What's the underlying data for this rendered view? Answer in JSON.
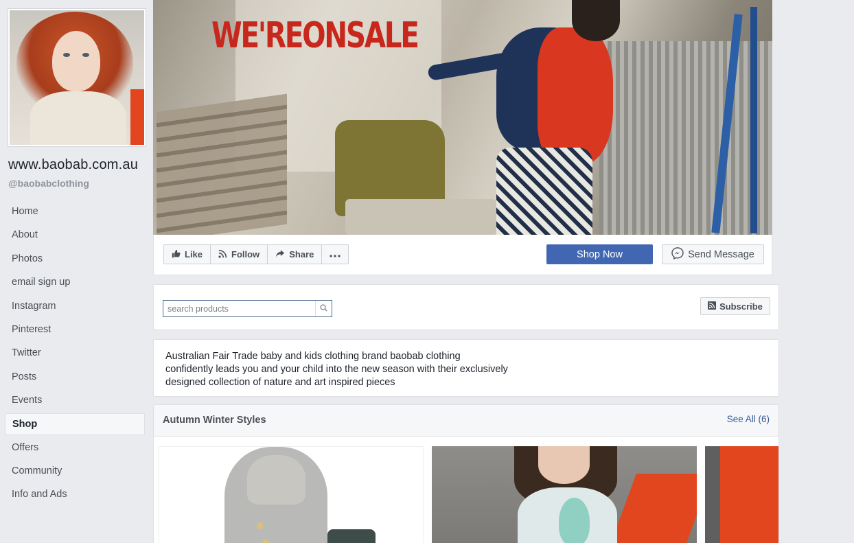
{
  "page": {
    "name": "www.baobab.com.au",
    "handle": "@baobabclothing"
  },
  "nav": {
    "items": [
      "Home",
      "About",
      "Photos",
      "email sign up",
      "Instagram",
      "Pinterest",
      "Twitter",
      "Posts",
      "Events",
      "Shop",
      "Offers",
      "Community",
      "Info and Ads"
    ],
    "active": "Shop"
  },
  "cover": {
    "sale_text": "WE'REONSALE"
  },
  "actions": {
    "like": "Like",
    "follow": "Follow",
    "share": "Share",
    "shop_now": "Shop Now",
    "send_message": "Send Message"
  },
  "search": {
    "placeholder": "search products",
    "subscribe": "Subscribe"
  },
  "about": {
    "lines": [
      "Australian Fair Trade baby and kids clothing brand baobab clothing",
      "confidently leads you and your child into the new season with their exclusively",
      "designed collection of nature and art inspired pieces"
    ]
  },
  "products": {
    "title": "Autumn Winter Styles",
    "see_all": "See All (6)"
  },
  "colors": {
    "brand_blue": "#4267b2",
    "link_blue": "#365899",
    "sale_red": "#c8271c",
    "background": "#e9ebee"
  },
  "icons": [
    "thumbs-up-icon",
    "rss-icon",
    "share-arrow-icon",
    "more-icon",
    "messenger-icon",
    "search-icon",
    "rss-icon"
  ]
}
